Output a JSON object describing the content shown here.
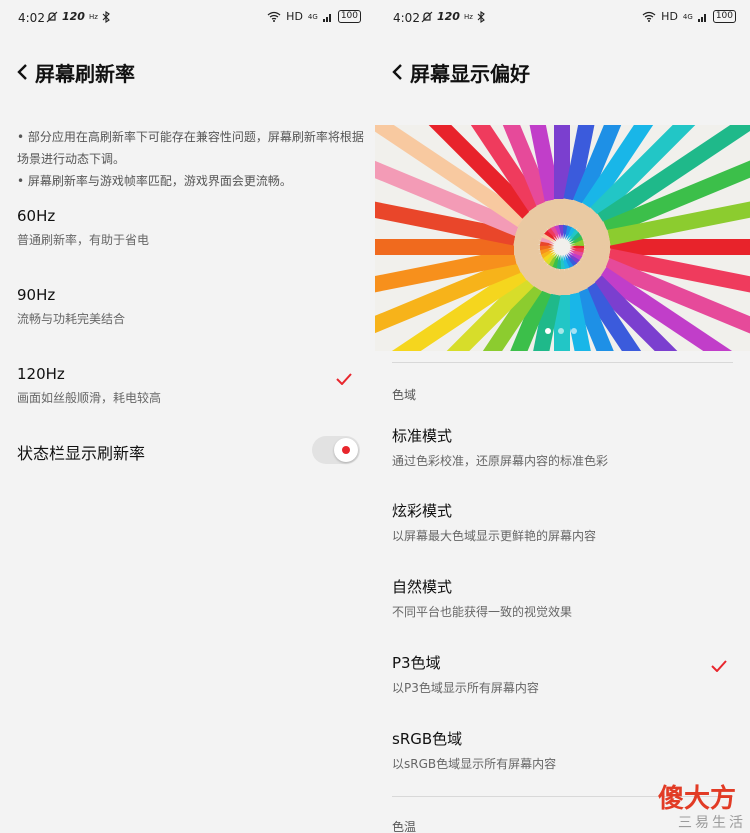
{
  "status": {
    "time": "4:02",
    "hz": "120",
    "hz_unit": "Hz",
    "hd": "HD",
    "net": "4G",
    "battery": "100"
  },
  "left": {
    "title": "屏幕刷新率",
    "notes": [
      "• 部分应用在高刷新率下可能存在兼容性问题，屏幕刷新率将根据场景进行动态下调。",
      "• 屏幕刷新率与游戏帧率匹配，游戏界面会更流畅。"
    ],
    "options": [
      {
        "label": "60Hz",
        "desc": "普通刷新率，有助于省电"
      },
      {
        "label": "90Hz",
        "desc": "流畅与功耗完美结合"
      },
      {
        "label": "120Hz",
        "desc": "画面如丝般顺滑，耗电较高"
      }
    ],
    "toggle_label": "状态栏显示刷新率"
  },
  "right": {
    "title": "屏幕显示偏好",
    "section_gamut": "色域",
    "options": [
      {
        "label": "标准模式",
        "desc": "通过色彩校准，还原屏幕内容的标准色彩"
      },
      {
        "label": "炫彩模式",
        "desc": "以屏幕最大色域显示更鲜艳的屏幕内容"
      },
      {
        "label": "自然模式",
        "desc": "不同平台也能获得一致的视觉效果"
      },
      {
        "label": "P3色域",
        "desc": "以P3色域显示所有屏幕内容"
      },
      {
        "label": "sRGB色域",
        "desc": "以sRGB色域显示所有屏幕内容"
      }
    ],
    "section_temp": "色温"
  },
  "watermark": {
    "main": "傻大方",
    "sub": "三易生活"
  },
  "colors": {
    "accent": "#e8262d"
  }
}
